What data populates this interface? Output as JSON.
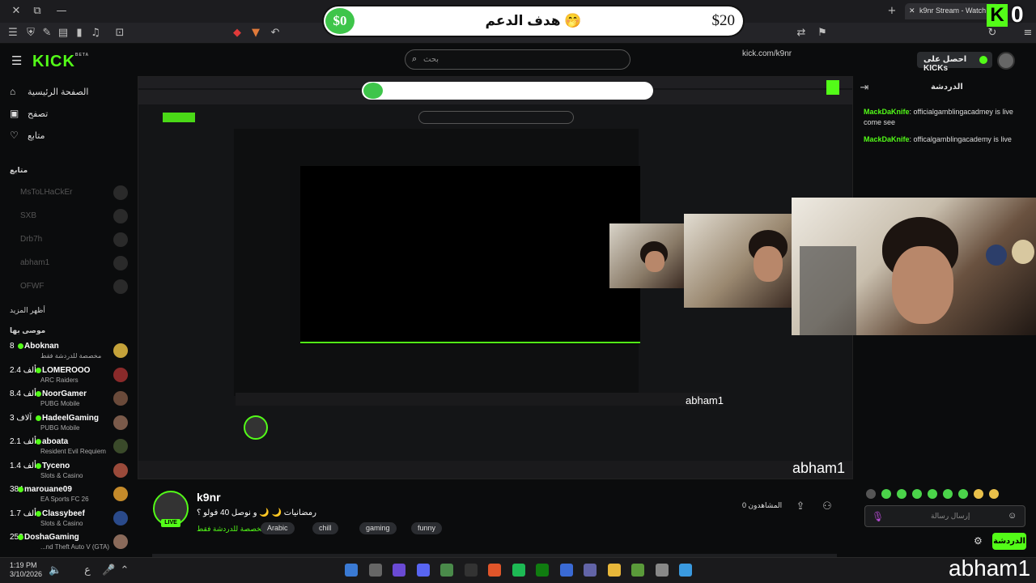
{
  "browser": {
    "tab_title": "k9nr Stream - Watch Li",
    "url": "kick.com/k9nr"
  },
  "goal": {
    "current": "$0",
    "title": "هدف الدعم 🤭",
    "max": "$20"
  },
  "kick_counter": {
    "logo": "K",
    "count": "0"
  },
  "header": {
    "logo": "KICK",
    "logo_sup": "BETA",
    "search_placeholder": "بحث",
    "kicks_button": "احصل على KICKs"
  },
  "sidebar": {
    "nav": [
      {
        "label": "الصفحة الرئيسية",
        "icon": "home-icon",
        "glyph": "⌂"
      },
      {
        "label": "تصفح",
        "icon": "browse-icon",
        "glyph": "▣"
      },
      {
        "label": "متابع",
        "icon": "heart-icon",
        "glyph": "♡"
      }
    ],
    "following_label": "متابع",
    "offline": [
      "MsToLHaCkEr",
      "SXB",
      "Drb7h",
      "abham1",
      "OFWF"
    ],
    "show_more": "أظهر المزيد",
    "recommended_label": "موصى بها",
    "recommended": [
      {
        "count": "8",
        "name": "Aboknan",
        "category": "مخصصة للدردشة فقط"
      },
      {
        "count": "2.4 ألف",
        "name": "LOMEROOO",
        "category": "ARC Raiders"
      },
      {
        "count": "8.4 ألف",
        "name": "NoorGamer",
        "category": "PUBG Mobile"
      },
      {
        "count": "3 آلاف",
        "name": "HadeelGaming",
        "category": "PUBG Mobile"
      },
      {
        "count": "2.1 ألف",
        "name": "aboata",
        "category": "Resident Evil Requiem"
      },
      {
        "count": "1.4 ألف",
        "name": "Tyceno",
        "category": "Slots & Casino"
      },
      {
        "count": "384",
        "name": "marouane09",
        "category": "EA Sports FC 26"
      },
      {
        "count": "1.7 ألف",
        "name": "Classybeef",
        "category": "Slots & Casino"
      },
      {
        "count": "252",
        "name": "DoshaGaming",
        "category": "...nd Theft Auto V (GTA)"
      }
    ]
  },
  "stream": {
    "streamer": "k9nr",
    "title": "رمضانيات 🌙 🌙 و نوصل 40 فولو ؟",
    "category": "مخصصة للدردشة فقط",
    "live": "LIVE",
    "tags": [
      "Arabic",
      "chill",
      "gaming",
      "funny"
    ],
    "viewers": "المشاهدون 0"
  },
  "chat": {
    "title": "الدردشة",
    "messages": [
      {
        "user": "MackDaKnife",
        "text": "officialgamblingacadmey is live come see"
      },
      {
        "user": "MackDaKnife",
        "text": "officalgamblingacademy is live"
      }
    ],
    "placeholder": "إرسال رسالة",
    "send": "الدردشة"
  },
  "taskbar": {
    "time": "1:19 PM",
    "date": "3/10/2026"
  },
  "watermark": "abham1"
}
